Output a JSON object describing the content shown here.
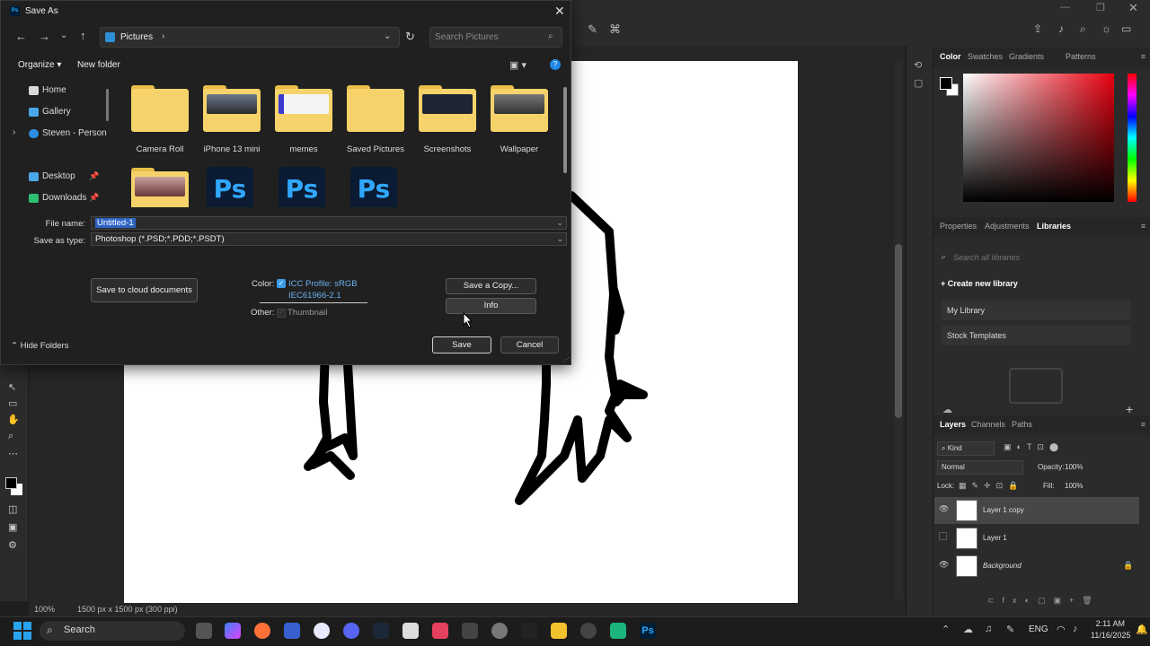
{
  "dialog": {
    "title": "Save As",
    "address": "Pictures",
    "search_placeholder": "Search Pictures",
    "organize_label": "Organize",
    "new_folder_label": "New folder",
    "nav_items": [
      {
        "label": "Home"
      },
      {
        "label": "Gallery"
      },
      {
        "label": "Steven - Persona"
      },
      {
        "label": "Desktop"
      },
      {
        "label": "Downloads"
      }
    ],
    "folders": [
      {
        "label": "Camera Roll"
      },
      {
        "label": "iPhone 13 mini"
      },
      {
        "label": "memes"
      },
      {
        "label": "Saved Pictures"
      },
      {
        "label": "Screenshots"
      },
      {
        "label": "Wallpaper"
      }
    ],
    "psd_icon_text": "Ps",
    "file_name_label": "File name:",
    "file_name_value": "Untitled-1",
    "save_type_label": "Save as type:",
    "save_type_value": "Photoshop (*.PSD;*.PDD;*.PSDT)",
    "cloud_button": "Save to cloud documents",
    "color_label": "Color:",
    "icc_profile": "ICC Profile: sRGB",
    "icc_profile_line2": "IEC61966-2.1",
    "other_label": "Other:",
    "thumbnail_label": "Thumbnail",
    "save_copy_button": "Save a Copy...",
    "info_button": "Info",
    "hide_folders": "Hide Folders",
    "save_button": "Save",
    "cancel_button": "Cancel"
  },
  "photoshop": {
    "color_tabs": [
      "Color",
      "Swatches",
      "Gradients",
      "Patterns"
    ],
    "libs_tabs": [
      "Properties",
      "Adjustments",
      "Libraries"
    ],
    "libs_search_placeholder": "Search all libraries",
    "create_library": "Create new library",
    "libraries": [
      "My Library",
      "Stock Templates"
    ],
    "layers_tabs": [
      "Layers",
      "Channels",
      "Paths"
    ],
    "kind_label": "Kind",
    "blend_mode": "Normal",
    "opacity_label": "Opacity:",
    "opacity_value": "100%",
    "lock_label": "Lock:",
    "fill_label": "Fill:",
    "fill_value": "100%",
    "layers": [
      {
        "name": "Layer 1 copy",
        "visible": true,
        "selected": true
      },
      {
        "name": "Layer 1",
        "visible": false,
        "selected": false
      },
      {
        "name": "Background",
        "visible": true,
        "selected": false
      }
    ],
    "zoom": "100%",
    "doc_size": "1500 px x 1500 px (300 ppi)",
    "foreground_color": "#000000",
    "background_color": "#ffffff"
  },
  "taskbar": {
    "search_label": "Search",
    "language": "ENG",
    "time": "2:11 AM",
    "date": "11/16/2025"
  }
}
